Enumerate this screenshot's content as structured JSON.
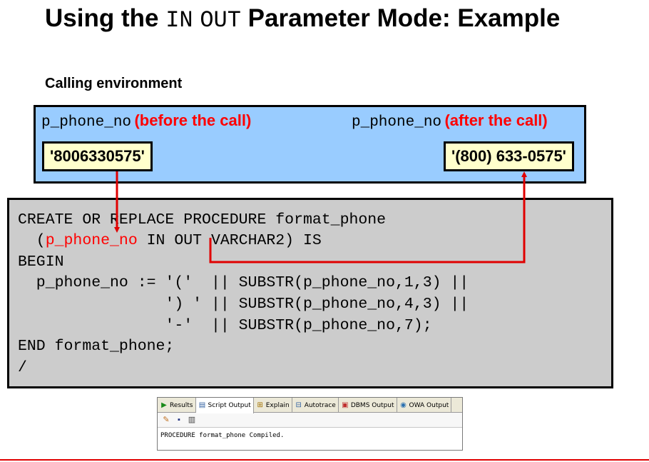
{
  "title": {
    "prefix": "Using the ",
    "keyword_in": "IN",
    "keyword_out": "OUT",
    "suffix": " Parameter Mode: Example"
  },
  "env": {
    "label": "Calling environment",
    "before": {
      "var": "p_phone_no",
      "note": "(before the call)",
      "value": "'8006330575'"
    },
    "after": {
      "var": "p_phone_no",
      "note": "(after the call)",
      "value": "'(800) 633-0575'"
    }
  },
  "code": {
    "line1": "CREATE OR REPLACE PROCEDURE format_phone",
    "line2_open": "  (",
    "line2_param": "p_phone_no",
    "line2_rest": " IN OUT VARCHAR2) IS",
    "line3": "BEGIN",
    "line4": "  p_phone_no := '('  || SUBSTR(p_phone_no,1,3) ||",
    "line5": "                ') ' || SUBSTR(p_phone_no,4,3) ||",
    "line6": "                '-'  || SUBSTR(p_phone_no,7);",
    "line7": "END format_phone;",
    "line8": "/"
  },
  "output_panel": {
    "tabs": [
      {
        "label": "Results",
        "icon": "play-icon"
      },
      {
        "label": "Script Output",
        "icon": "script-icon"
      },
      {
        "label": "Explain",
        "icon": "explain-icon"
      },
      {
        "label": "Autotrace",
        "icon": "autotrace-icon"
      },
      {
        "label": "DBMS Output",
        "icon": "dbms-icon"
      },
      {
        "label": "OWA Output",
        "icon": "owa-icon"
      }
    ],
    "active_tab": "Script Output",
    "toolbar": [
      "eraser-icon",
      "save-icon",
      "print-icon"
    ],
    "output_text": "PROCEDURE format_phone Compiled."
  },
  "colors": {
    "env_bg": "#99ccff",
    "value_bg": "#ffffcc",
    "code_bg": "#cccccc",
    "accent_red": "#ff0000"
  }
}
